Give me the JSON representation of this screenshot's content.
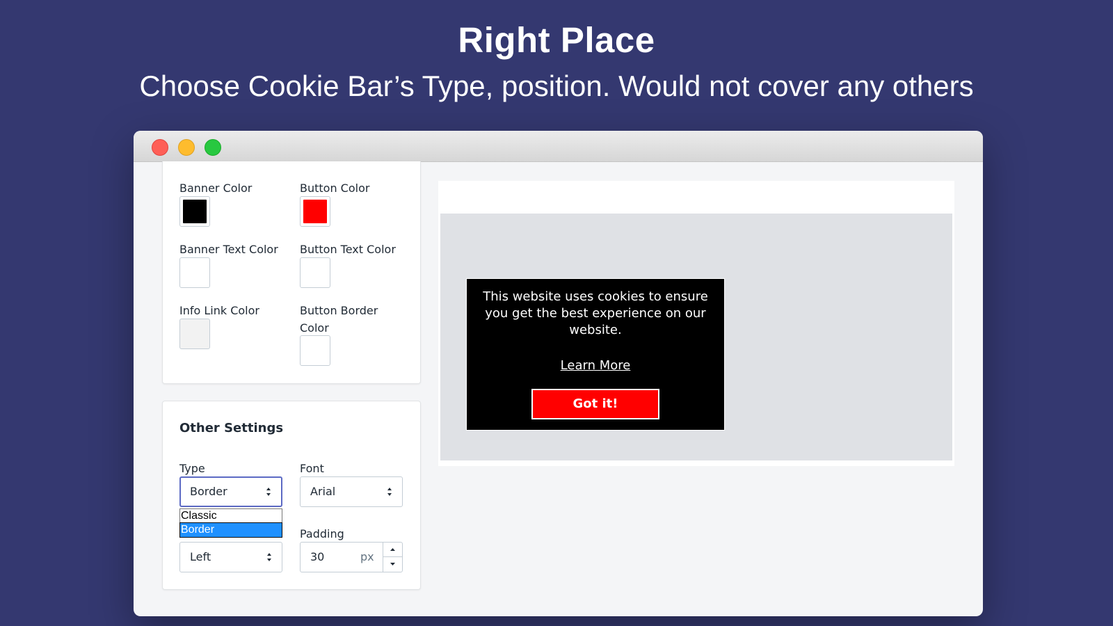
{
  "hero": {
    "title": "Right Place",
    "subtitle": "Choose Cookie Bar’s Type, position. Would not cover any others"
  },
  "colors_card": {
    "banner_color": {
      "label": "Banner Color",
      "value": "#000000"
    },
    "button_color": {
      "label": "Button Color",
      "value": "#ff0000"
    },
    "banner_text_color": {
      "label": "Banner Text Color",
      "value": "#ffffff"
    },
    "button_text_color": {
      "label": "Button Text Color",
      "value": "#ffffff"
    },
    "info_link_color": {
      "label": "Info Link Color",
      "value": "#f2f2f2"
    },
    "button_border_color": {
      "label": "Button Border Color",
      "value": "#ffffff"
    }
  },
  "other_settings": {
    "title": "Other Settings",
    "type": {
      "label": "Type",
      "value": "Border",
      "options": [
        "Classic",
        "Border"
      ],
      "selected_option": "Border"
    },
    "font": {
      "label": "Font",
      "value": "Arial"
    },
    "position": {
      "value": "Left"
    },
    "padding": {
      "label": "Padding",
      "value": "30",
      "unit": "px"
    }
  },
  "cookie_preview": {
    "message": "This website uses cookies to ensure you get the best experience on our website.",
    "link_text": "Learn More",
    "button_text": "Got it!",
    "background": "#000000",
    "button_color": "#ff0000"
  }
}
